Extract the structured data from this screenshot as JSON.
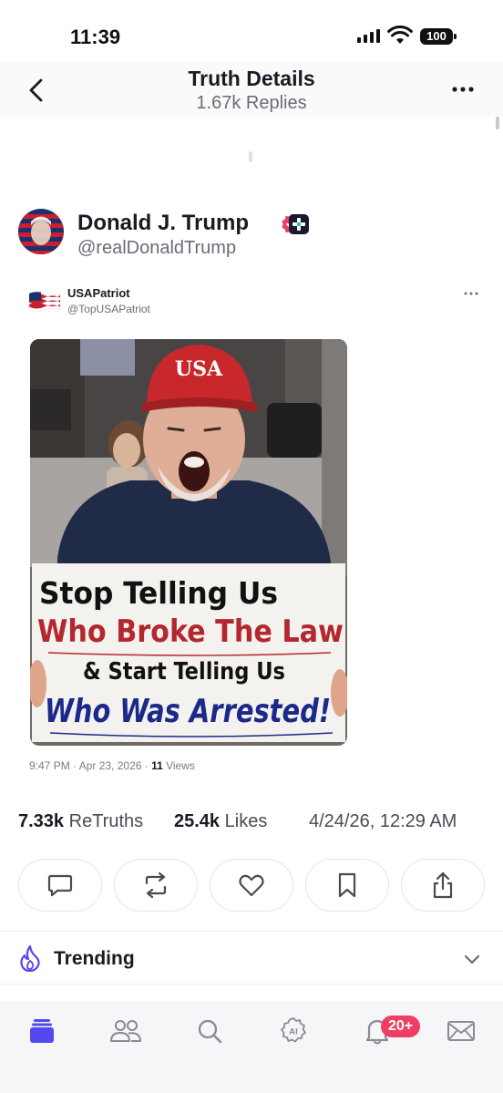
{
  "status_bar": {
    "time": "11:39",
    "battery": "100"
  },
  "header": {
    "title": "Truth Details",
    "subtitle": "1.67k Replies"
  },
  "author": {
    "name": "Donald J. Trump",
    "handle": "@realDonaldTrump"
  },
  "quoted_post": {
    "name": "USAPatriot",
    "handle": "@TopUSAPatriot",
    "image": {
      "hat_text": "USA",
      "sign_lines": [
        "Stop Telling Us",
        "Who Broke The Law",
        "& Start Telling Us",
        "Who Was Arrested!"
      ]
    },
    "meta_time": "9:47 PM · Apr 23, 2026 · ",
    "meta_views_count": "11",
    "meta_views_label": " Views"
  },
  "stats": {
    "retruths_count": "7.33k",
    "retruths_label": "ReTruths",
    "likes_count": "25.4k",
    "likes_label": "Likes",
    "date": "4/24/26, 12:29 AM"
  },
  "actions": [
    "reply-icon",
    "retruth-icon",
    "like-icon",
    "bookmark-icon",
    "share-icon"
  ],
  "trending": {
    "label": "Trending"
  },
  "tabbar": {
    "items": [
      "feed-icon",
      "people-icon",
      "search-icon",
      "ai-icon",
      "bell-icon",
      "mail-icon"
    ],
    "notification_badge": "20+"
  },
  "colors": {
    "accent": "#5448ee",
    "verified": "#ee3e64",
    "badge": "#ee3e64",
    "sign_red": "#b3272f",
    "sign_blue": "#1b2a8a"
  }
}
